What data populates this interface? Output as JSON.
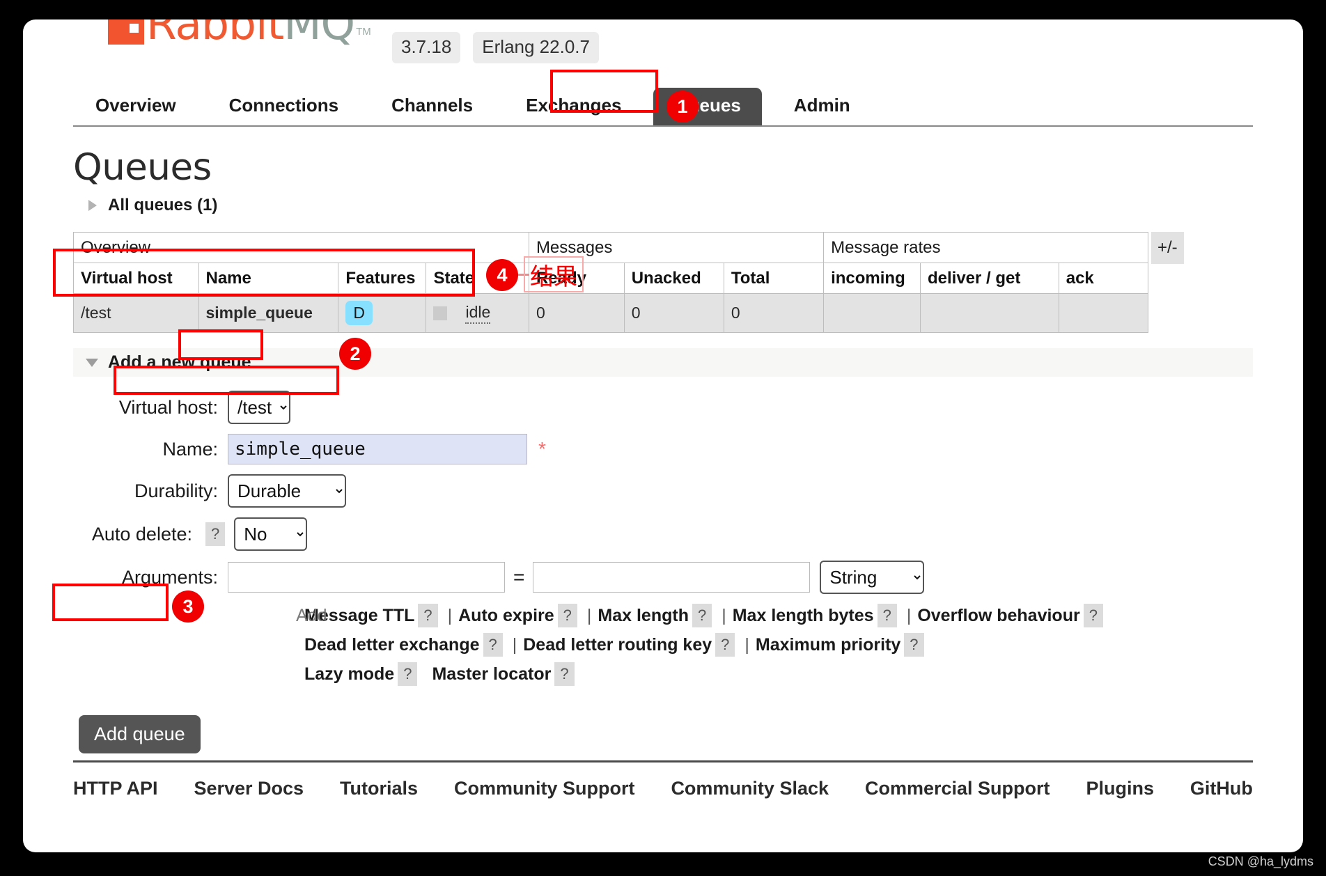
{
  "brand": {
    "name_part1": "Rabbit",
    "name_part2": "MQ",
    "tm": "TM",
    "version": "3.7.18",
    "erlang_version": "Erlang 22.0.7"
  },
  "nav": {
    "tabs": [
      {
        "label": "Overview",
        "active": false
      },
      {
        "label": "Connections",
        "active": false
      },
      {
        "label": "Channels",
        "active": false
      },
      {
        "label": "Exchanges",
        "active": false
      },
      {
        "label": "Queues",
        "active": true
      },
      {
        "label": "Admin",
        "active": false
      }
    ]
  },
  "page": {
    "title": "Queues",
    "all_queues_label": "All queues (1)"
  },
  "table": {
    "group_headers": {
      "overview": "Overview",
      "messages": "Messages",
      "message_rates": "Message rates"
    },
    "columns": [
      "Virtual host",
      "Name",
      "Features",
      "State",
      "Ready",
      "Unacked",
      "Total",
      "incoming",
      "deliver / get",
      "ack"
    ],
    "toggle_label": "+/-",
    "rows": [
      {
        "virtual_host": "/test",
        "name": "simple_queue",
        "features": "D",
        "state": "idle",
        "ready": "0",
        "unacked": "0",
        "total": "0",
        "incoming": "",
        "deliver_get": "",
        "ack": ""
      }
    ]
  },
  "add_queue": {
    "section_title": "Add a new queue",
    "virtual_host_label": "Virtual host:",
    "virtual_host_value": "/test",
    "name_label": "Name:",
    "name_value": "simple_queue",
    "name_required_mark": "*",
    "durability_label": "Durability:",
    "durability_value": "Durable",
    "auto_delete_label": "Auto delete:",
    "auto_delete_value": "No",
    "arguments_label": "Arguments:",
    "arguments_key": "",
    "arguments_value": "",
    "arguments_equals": "=",
    "arguments_type": "String",
    "add_word": "Add",
    "help_mark": "?",
    "separator": "|",
    "preset_rows": [
      [
        "Message TTL",
        "Auto expire",
        "Max length",
        "Max length bytes",
        "Overflow behaviour"
      ],
      [
        "Dead letter exchange",
        "Dead letter routing key",
        "Maximum priority"
      ],
      [
        "Lazy mode",
        "Master locator"
      ]
    ],
    "submit_label": "Add queue"
  },
  "footer": {
    "links": [
      "HTTP API",
      "Server Docs",
      "Tutorials",
      "Community Support",
      "Community Slack",
      "Commercial Support",
      "Plugins",
      "GitHub"
    ]
  },
  "annotations": {
    "badges": [
      "1",
      "2",
      "3",
      "4"
    ],
    "callout_text": "结果"
  },
  "watermark": "CSDN @ha_lydms",
  "colors": {
    "brand_orange": "#f05a32",
    "brand_gray": "#90a09a",
    "active_tab": "#4c4c4c",
    "feature_badge": "#87e0ff",
    "annotation_red": "#ff0000",
    "input_highlight": "#dee3f5"
  }
}
